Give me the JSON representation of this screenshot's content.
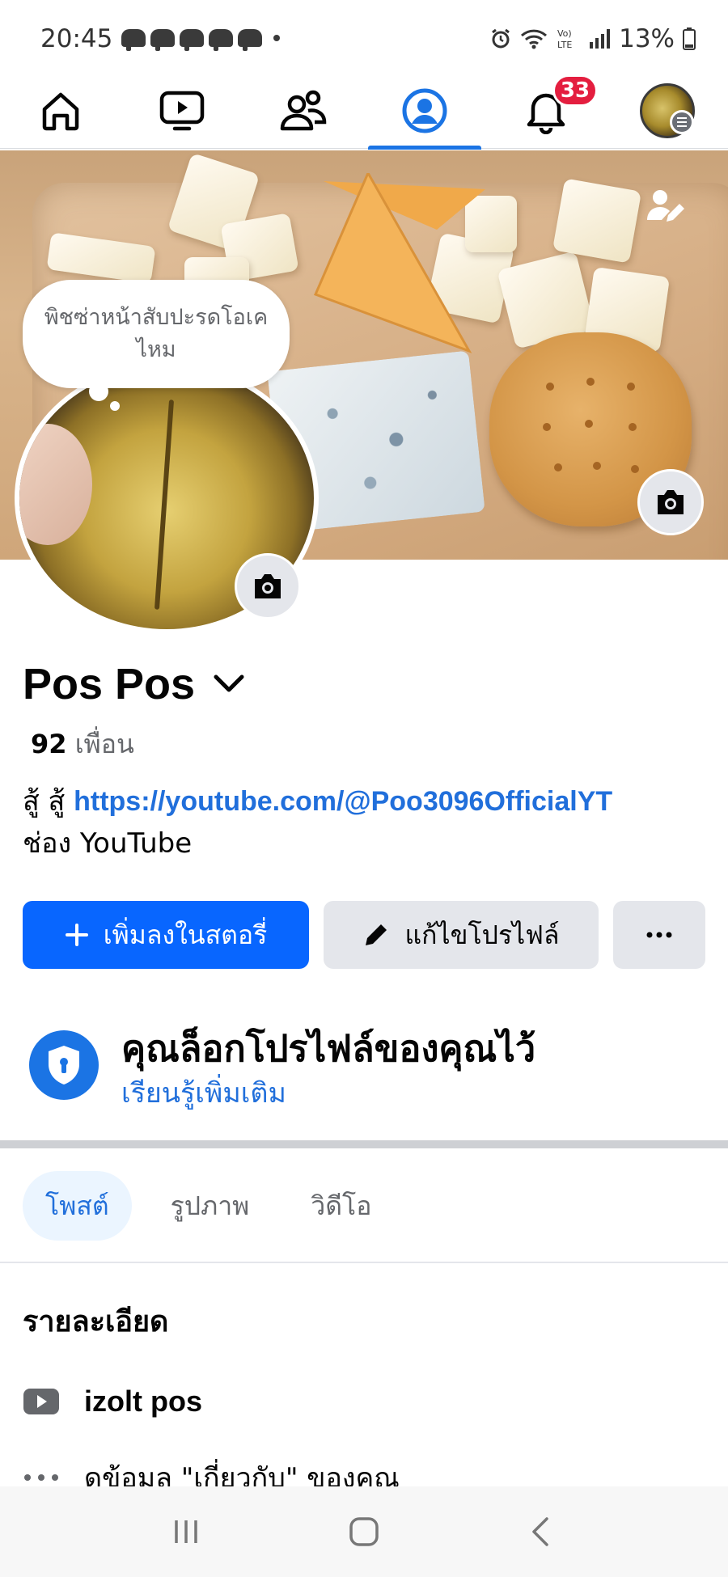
{
  "status_bar": {
    "time": "20:45",
    "battery": "13%",
    "notification_count_icons": 5
  },
  "top_nav": {
    "items": [
      {
        "name": "home",
        "active": false
      },
      {
        "name": "video",
        "active": false
      },
      {
        "name": "friends",
        "active": false
      },
      {
        "name": "profile",
        "active": true
      },
      {
        "name": "notifications",
        "active": false,
        "badge": "33"
      },
      {
        "name": "menu",
        "active": false
      }
    ],
    "accent_color": "#1b74e4"
  },
  "note": {
    "text": "พิชซ่าหน้าสับปะรดโอเคไหม"
  },
  "profile": {
    "name": "Pos Pos",
    "friends_count": "92",
    "friends_label": "เพื่อน",
    "bio_prefix": "สู้ สู้",
    "bio_link": "https://youtube.com/@Poo3096OfficialYT",
    "bio_suffix": "ช่อง YouTube"
  },
  "actions": {
    "add_story": "เพิ่มลงในสตอรี่",
    "edit_profile": "แก้ไขโปรไฟล์",
    "more": "···"
  },
  "lock_notice": {
    "title": "คุณล็อกโปรไฟล์ของคุณไว้",
    "link": "เรียนรู้เพิ่มเติม"
  },
  "tabs": [
    {
      "label": "โพสต์",
      "active": true
    },
    {
      "label": "รูปภาพ",
      "active": false
    },
    {
      "label": "วิดีโอ",
      "active": false
    }
  ],
  "details": {
    "heading": "รายละเอียด",
    "items": [
      {
        "icon": "youtube-icon",
        "text": "izolt pos"
      },
      {
        "icon": "more-dots-icon",
        "text": "ดูข้อมูล \"เกี่ยวกับ\" ของคุณ"
      }
    ]
  },
  "colors": {
    "primary": "#0866ff",
    "link": "#216fdb",
    "badge": "#e41e3f"
  }
}
